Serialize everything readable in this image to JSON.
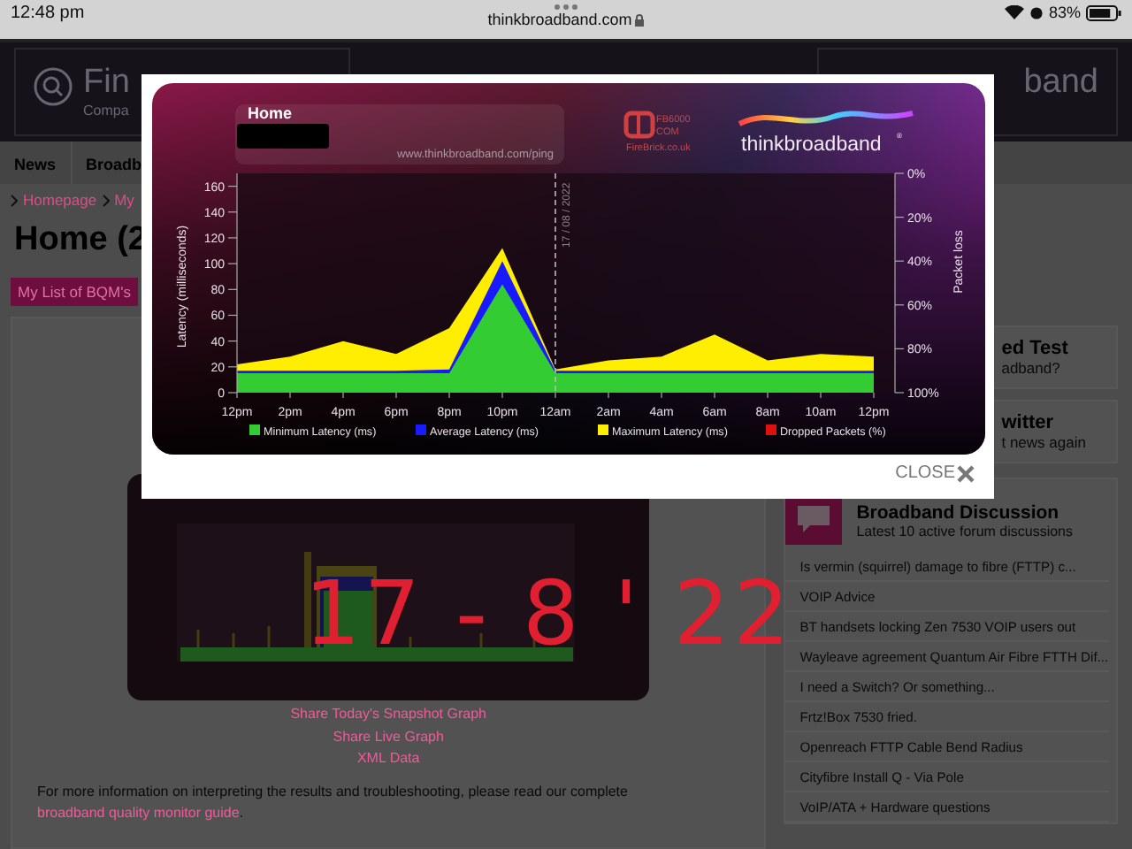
{
  "status_bar": {
    "time": "12:48 pm",
    "url": "thinkbroadband.com",
    "battery": "83%"
  },
  "header": {
    "tiles": [
      {
        "title": "Fin",
        "subtitle": "Compa"
      },
      {
        "title": "band"
      }
    ]
  },
  "nav": [
    "News",
    "Broadb"
  ],
  "breadcrumb": [
    "Homepage",
    "My"
  ],
  "page_title": "Home (2",
  "list_button": "My List of BQM's",
  "graph_links": [
    "Share Today's Snapshot Graph",
    "Share Live Graph",
    "XML Data"
  ],
  "more_info": {
    "text": "For more information on interpreting the results and troubleshooting, please read our complete",
    "link": "broadband quality monitor guide",
    "end": "."
  },
  "handwritten_note": "17 - 8 ' 22",
  "sidebar": {
    "cards": [
      {
        "title": "ed Test",
        "subtitle": "adband?"
      },
      {
        "title": "witter",
        "subtitle": "t news again"
      }
    ],
    "discussion": {
      "title": "Broadband Discussion",
      "subtitle": "Latest 10 active forum discussions",
      "topics": [
        "Is vermin (squirrel) damage to fibre (FTTP) c...",
        "VOIP Advice",
        "BT handsets locking Zen 7530 VOIP users out",
        "Wayleave agreement Quantum Air Fibre FTTH Dif...",
        "I need a Switch? Or something...",
        "Frtz!Box 7530 fried.",
        "Openreach FTTP Cable Bend Radius",
        "Cityfibre Install Q - Via Pole",
        "VoIP/ATA + Hardware questions"
      ]
    }
  },
  "modal": {
    "close_label": "CLOSE",
    "chart": {
      "location": "Home",
      "url": "www.thinkbroadband.com/ping",
      "sponsor": {
        "line1": "FB6000",
        "line2": "COM",
        "site": "FireBrick.co.uk"
      },
      "brand": "thinkbroadband",
      "brand_mark": "®",
      "date_marker": "17 / 08 / 2022",
      "chart_data": {
        "type": "area",
        "ylabel": "Latency (milliseconds)",
        "y2label": "Packet loss",
        "legend": true,
        "categories": [
          "12pm",
          "2pm",
          "4pm",
          "6pm",
          "8pm",
          "10pm",
          "12am",
          "2am",
          "4am",
          "6am",
          "8am",
          "10am",
          "12pm"
        ],
        "ylim": [
          0,
          170
        ],
        "yticks": [
          0,
          20,
          40,
          60,
          80,
          100,
          120,
          140,
          160
        ],
        "y2ticks": [
          "0%",
          "20%",
          "40%",
          "60%",
          "80%",
          "100%"
        ],
        "series": [
          {
            "name": "Maximum Latency (ms)",
            "color": "#ffee00",
            "values": [
              22,
              28,
              40,
              30,
              50,
              112,
              18,
              25,
              28,
              45,
              25,
              30,
              28
            ]
          },
          {
            "name": "Average Latency (ms)",
            "color": "#1a1aff",
            "values": [
              17,
              17,
              17,
              17,
              18,
              102,
              17,
              17,
              17,
              17,
              17,
              17,
              17
            ]
          },
          {
            "name": "Minimum Latency (ms)",
            "color": "#33cc33",
            "values": [
              15,
              15,
              15,
              15,
              15,
              84,
              15,
              15,
              15,
              15,
              15,
              15,
              15
            ]
          },
          {
            "name": "Dropped Packets (%)",
            "color": "#e01010",
            "values": [
              null,
              null,
              null,
              null,
              null,
              null,
              null,
              null,
              null,
              null,
              null,
              null,
              null
            ]
          }
        ]
      }
    }
  }
}
